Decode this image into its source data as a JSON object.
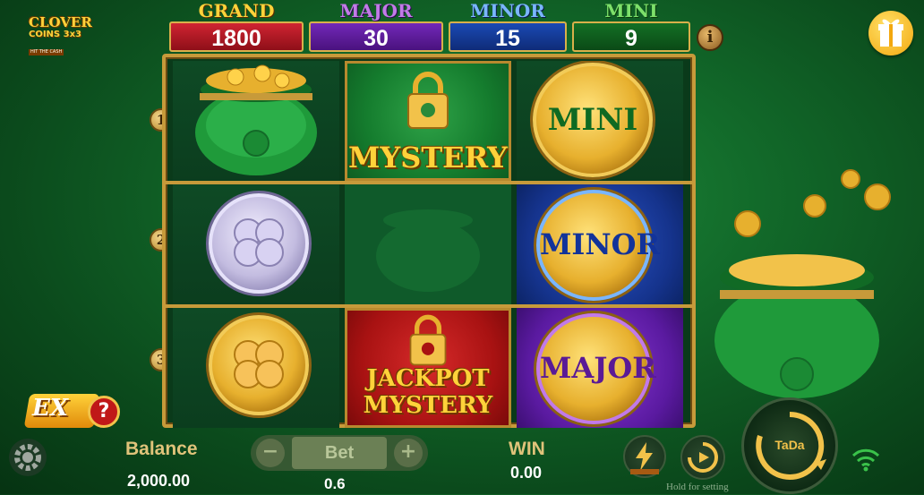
{
  "logo": {
    "line1": "CLOVER",
    "line2": "COINS 3x3",
    "line3": "HIT THE CASH"
  },
  "jackpots": [
    {
      "label": "GRAND",
      "value": "1800",
      "label_color": "#ffd23a",
      "box_color": "#b01622"
    },
    {
      "label": "MAJOR",
      "value": "30",
      "label_color": "#c27ae8",
      "box_color": "#5a1d96"
    },
    {
      "label": "MINOR",
      "value": "15",
      "label_color": "#7ab6ff",
      "box_color": "#123a92"
    },
    {
      "label": "MINI",
      "value": "9",
      "label_color": "#7de06a",
      "box_color": "#0f5a1e"
    }
  ],
  "info_glyph": "i",
  "rows": [
    "1",
    "2",
    "3"
  ],
  "grid": {
    "mystery_label": "MYSTERY",
    "jackpot_mystery_line1": "JACKPOT",
    "jackpot_mystery_line2": "MYSTERY",
    "mini_label": "MINI",
    "minor_label": "MINOR",
    "major_label": "MAJOR"
  },
  "ex_label": "EX",
  "ex_help": "?",
  "bottom": {
    "balance_label": "Balance",
    "balance_value": "2,000.00",
    "bet_label": "Bet",
    "bet_minus": "−",
    "bet_plus": "+",
    "bet_value": "0.6",
    "win_label": "WIN",
    "win_value": "0.00",
    "spin_label": "TaDa",
    "hold_hint": "Hold for setting"
  },
  "icons": [
    "settings-gear-icon",
    "bolt-icon",
    "autoplay-icon",
    "wifi-icon",
    "gift-icon",
    "info-icon"
  ]
}
